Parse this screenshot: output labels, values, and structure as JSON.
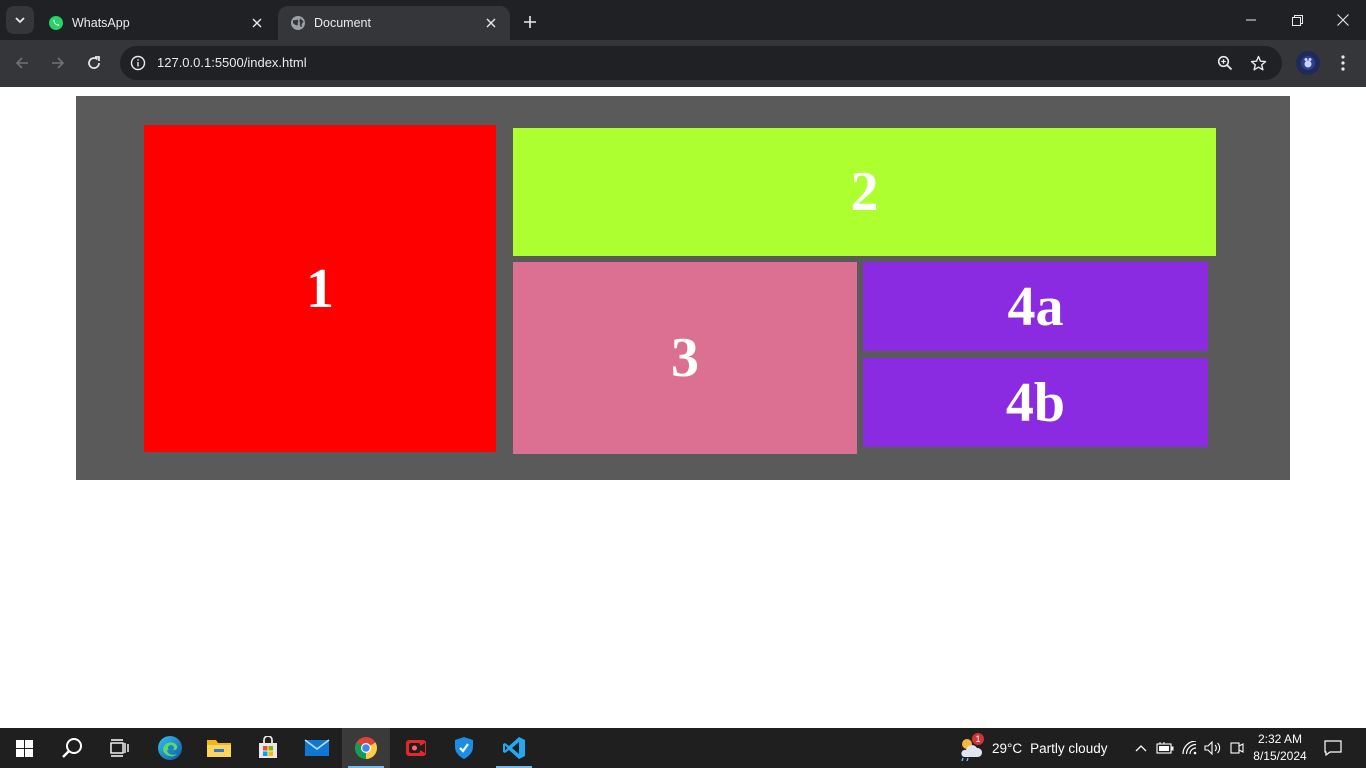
{
  "browser": {
    "tabs": [
      {
        "title": "WhatsApp",
        "active": false,
        "icon": "whatsapp-icon"
      },
      {
        "title": "Document",
        "active": true,
        "icon": "globe-icon"
      }
    ],
    "url": "127.0.0.1:5500/index.html"
  },
  "page": {
    "boxes": [
      {
        "label": "1",
        "color": "#ff0000"
      },
      {
        "label": "2",
        "color": "#adff2f"
      },
      {
        "label": "3",
        "color": "#db7093"
      },
      {
        "label": "4a",
        "color": "#8a2be2"
      },
      {
        "label": "4b",
        "color": "#8a2be2"
      }
    ],
    "container_color": "#5a5a5a"
  },
  "taskbar": {
    "apps": [
      "start-icon",
      "search-icon",
      "task-view-icon",
      "edge-icon",
      "file-explorer-icon",
      "store-icon",
      "mail-icon",
      "chrome-icon",
      "recorder-icon",
      "security-icon",
      "vscode-icon"
    ],
    "weather": {
      "temp": "29°C",
      "condition": "Partly cloudy",
      "badge": "1"
    },
    "time": "2:32 AM",
    "date": "8/15/2024"
  }
}
